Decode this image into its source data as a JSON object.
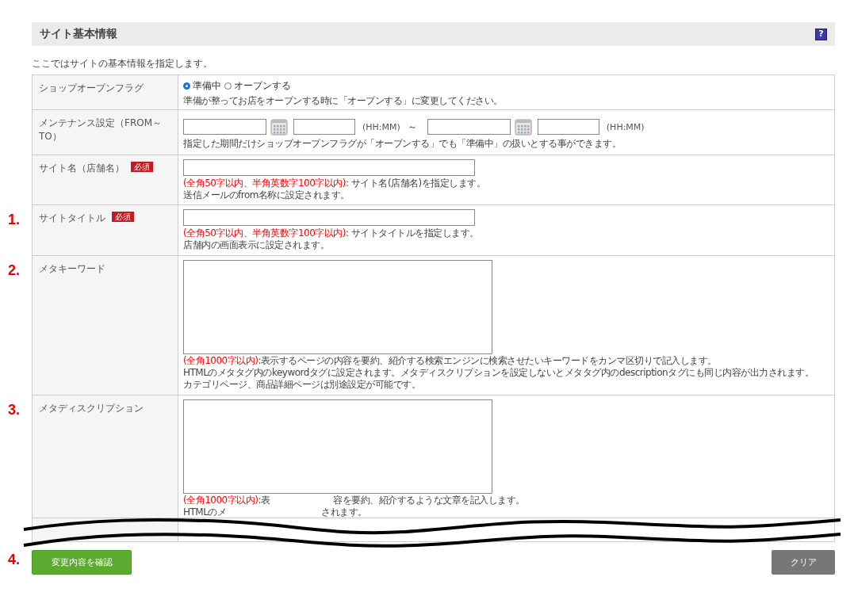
{
  "header": {
    "title": "サイト基本情報",
    "help": "?"
  },
  "intro": "ここではサイトの基本情報を指定します。",
  "rows": [
    {
      "kind": "radio",
      "label": "ショップオープンフラグ",
      "options": [
        {
          "label": "準備中",
          "selected": true
        },
        {
          "label": "オープンする",
          "selected": false
        }
      ],
      "notes": [
        "準備が整ってお店をオープンする時に「オープンする」に変更してください。"
      ]
    },
    {
      "kind": "datetime",
      "label": "メンテナンス設定（FROM～TO）",
      "time_hints": [
        "(HH:MM)",
        "(HH:MM)"
      ],
      "separator": "～",
      "notes": [
        "指定した期間だけショップオープンフラグが「オープンする」でも「準備中」の扱いとする事ができます。"
      ]
    },
    {
      "kind": "text",
      "label": "サイト名（店舗名）",
      "required": "必須",
      "limit": "(全角50字以内、半角英数字100字以内)",
      "notes": [
        " : サイト名(店舗名)を指定します。",
        "送信メールのfrom名称に設定されます。"
      ]
    },
    {
      "kind": "text",
      "marker": "1.",
      "label": "サイトタイトル",
      "required": "必須",
      "limit": "(全角50字以内、半角英数字100字以内)",
      "notes": [
        " : サイトタイトルを指定します。",
        "店舗内の画面表示に設定されます。"
      ]
    },
    {
      "kind": "textarea",
      "marker": "2.",
      "label": "メタキーワード",
      "limit": "(全角1000字以内)",
      "notes": [
        ":表示するページの内容を要約、紹介する検索エンジンに検索させたいキーワードをカンマ区切りで記入します。",
        "HTMLのメタタグ内のkeywordタグに設定されます。メタディスクリプションを設定しないとメタタグ内のdescriptionタグにも同じ内容が出力されます。",
        "カテゴリページ、商品詳細ページは別途設定が可能です。"
      ]
    },
    {
      "kind": "textarea",
      "marker": "3.",
      "label": "メタディスクリプション",
      "limit": "(全角1000字以内)",
      "notes": [
        [
          ":表",
          "容を要約、紹介するような文章を記入します。"
        ],
        [
          "HTMLのメ",
          "されます。"
        ]
      ]
    }
  ],
  "buttons": {
    "marker": "4.",
    "confirm": "変更内容を確認",
    "clear": "クリア"
  }
}
